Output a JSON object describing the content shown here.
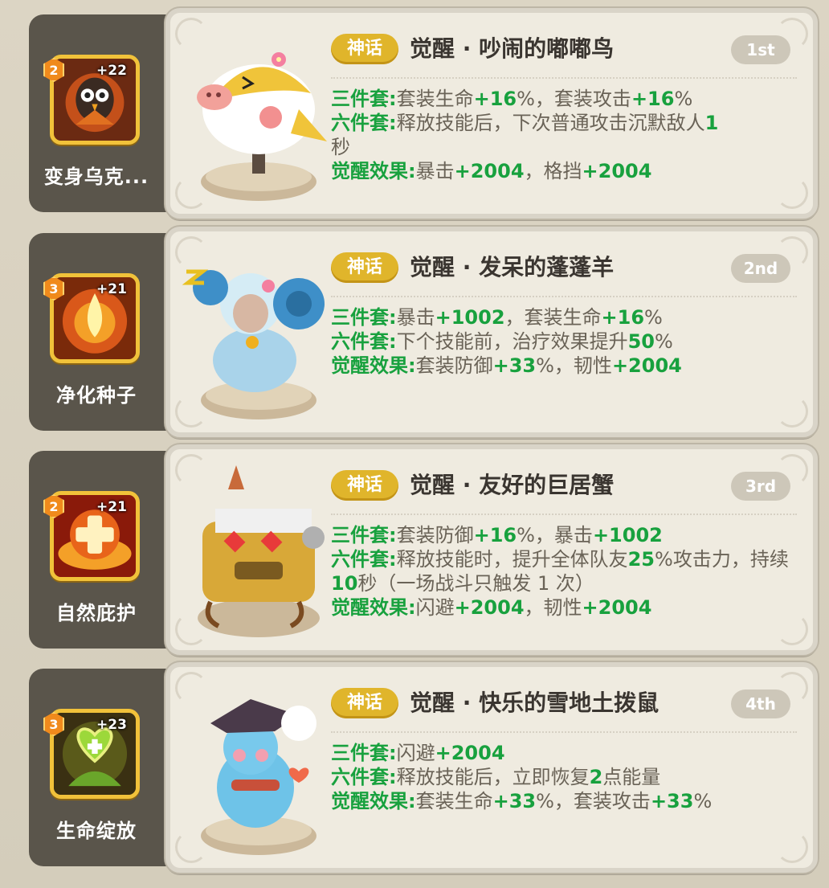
{
  "entries": [
    {
      "skill": {
        "level": "2",
        "plus": "+22",
        "name": "变身乌克..."
      },
      "tier": "神话",
      "title": "觉醒 · 吵闹的嘟嘟鸟",
      "rank": "1st",
      "three_set": {
        "label": "三件套:",
        "t1": "套装生命",
        "n1": "+16",
        "t2": "%，套装攻击",
        "n2": "+16",
        "t3": "%"
      },
      "six_set": {
        "label": "六件套:",
        "t1": "释放技能后，下次普通攻击沉默敌人",
        "n1": "1",
        "t2": "秒"
      },
      "awaken": {
        "label": "觉醒效果:",
        "t1": "暴击",
        "n1": "+2004",
        "t2": "，格挡",
        "n2": "+2004"
      }
    },
    {
      "skill": {
        "level": "3",
        "plus": "+21",
        "name": "净化种子"
      },
      "tier": "神话",
      "title": "觉醒 · 发呆的蓬蓬羊",
      "rank": "2nd",
      "three_set": {
        "label": "三件套:",
        "t1": "暴击",
        "n1": "+1002",
        "t2": "，套装生命",
        "n2": "+16",
        "t3": "%"
      },
      "six_set": {
        "label": "六件套:",
        "t1": "下个技能前，治疗效果提升",
        "n1": "50",
        "t2": "%"
      },
      "awaken": {
        "label": "觉醒效果:",
        "t1": "套装防御",
        "n1": "+33",
        "t2": "%，韧性",
        "n2": "+2004"
      }
    },
    {
      "skill": {
        "level": "2",
        "plus": "+21",
        "name": "自然庇护"
      },
      "tier": "神话",
      "title": "觉醒 · 友好的巨居蟹",
      "rank": "3rd",
      "three_set": {
        "label": "三件套:",
        "t1": "套装防御",
        "n1": "+16",
        "t2": "%，暴击",
        "n2": "+1002",
        "t3": ""
      },
      "six_set": {
        "label": "六件套:",
        "t1": "释放技能时，提升全体队友",
        "n1": "25",
        "t2": "%攻击力，持续",
        "n2": "10",
        "t3": "秒（一场战斗只触发 1 次）"
      },
      "awaken": {
        "label": "觉醒效果:",
        "t1": "闪避",
        "n1": "+2004",
        "t2": "，韧性",
        "n2": "+2004"
      }
    },
    {
      "skill": {
        "level": "3",
        "plus": "+23",
        "name": "生命绽放"
      },
      "tier": "神话",
      "title": "觉醒 · 快乐的雪地土拨鼠",
      "rank": "4th",
      "three_set": {
        "label": "三件套:",
        "t1": "闪避",
        "n1": "+2004",
        "t2": "",
        "n2": "",
        "t3": ""
      },
      "six_set": {
        "label": "六件套:",
        "t1": "释放技能后，立即恢复",
        "n1": "2",
        "t2": "点能量"
      },
      "awaken": {
        "label": "觉醒效果:",
        "t1": "套装生命",
        "n1": "+33",
        "t2": "%，套装攻击",
        "n2": "+33",
        "t3": "%"
      }
    }
  ]
}
